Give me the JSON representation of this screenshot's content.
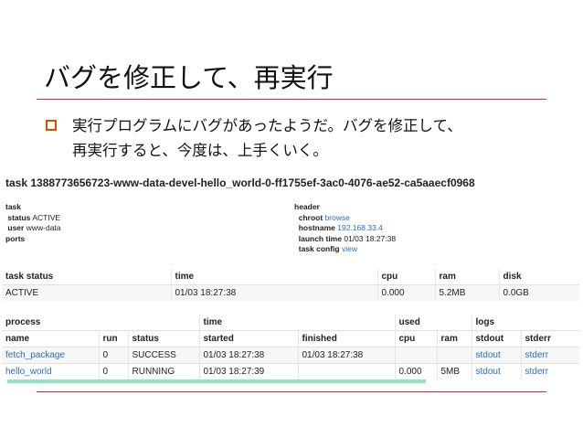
{
  "slide": {
    "title": "バグを修正して、再実行",
    "bullet_line1": "実行プログラムにバグがあったようだ。バグを修正して、",
    "bullet_line2": "再実行すると、今度は、上手くいく。"
  },
  "task": {
    "title": "task 1388773656723-www-data-devel-hello_world-0-ff1755ef-3ac0-4076-ae52-ca5aaecf0968",
    "left": {
      "heading": "task",
      "status_label": "status",
      "status_value": "ACTIVE",
      "user_label": "user",
      "user_value": "www-data",
      "ports_label": "ports"
    },
    "right": {
      "heading": "header",
      "chroot_label": "chroot",
      "chroot_link": "browse",
      "hostname_label": "hostname",
      "hostname_value": "192.168.33.4",
      "launch_label": "launch time",
      "launch_value": "01/03 18:27:38",
      "config_label": "task config",
      "config_link": "view"
    }
  },
  "status_table": {
    "headers": [
      "task status",
      "time",
      "cpu",
      "ram",
      "disk"
    ],
    "row": [
      "ACTIVE",
      "01/03 18:27:38",
      "0.000",
      "5.2MB",
      "0.0GB"
    ]
  },
  "process_table": {
    "group_headers": [
      "process",
      "time",
      "used",
      "logs"
    ],
    "sub_headers": [
      "name",
      "run",
      "status",
      "started",
      "finished",
      "cpu",
      "ram",
      "stdout",
      "stderr"
    ],
    "rows": [
      [
        "fetch_package",
        "0",
        "SUCCESS",
        "01/03 18:27:38",
        "01/03 18:27:38",
        "",
        "",
        "stdout",
        "stderr"
      ],
      [
        "hello_world",
        "0",
        "RUNNING",
        "01/03 18:27:39",
        "",
        "0.000",
        "5MB",
        "stdout",
        "stderr"
      ]
    ]
  },
  "colors": {
    "accent": "#c0392b",
    "bullet": "#d35400",
    "link": "#2a6fb8",
    "progress": "#8fe3c2"
  },
  "icons": {
    "bullet": "square-bullet-icon"
  }
}
